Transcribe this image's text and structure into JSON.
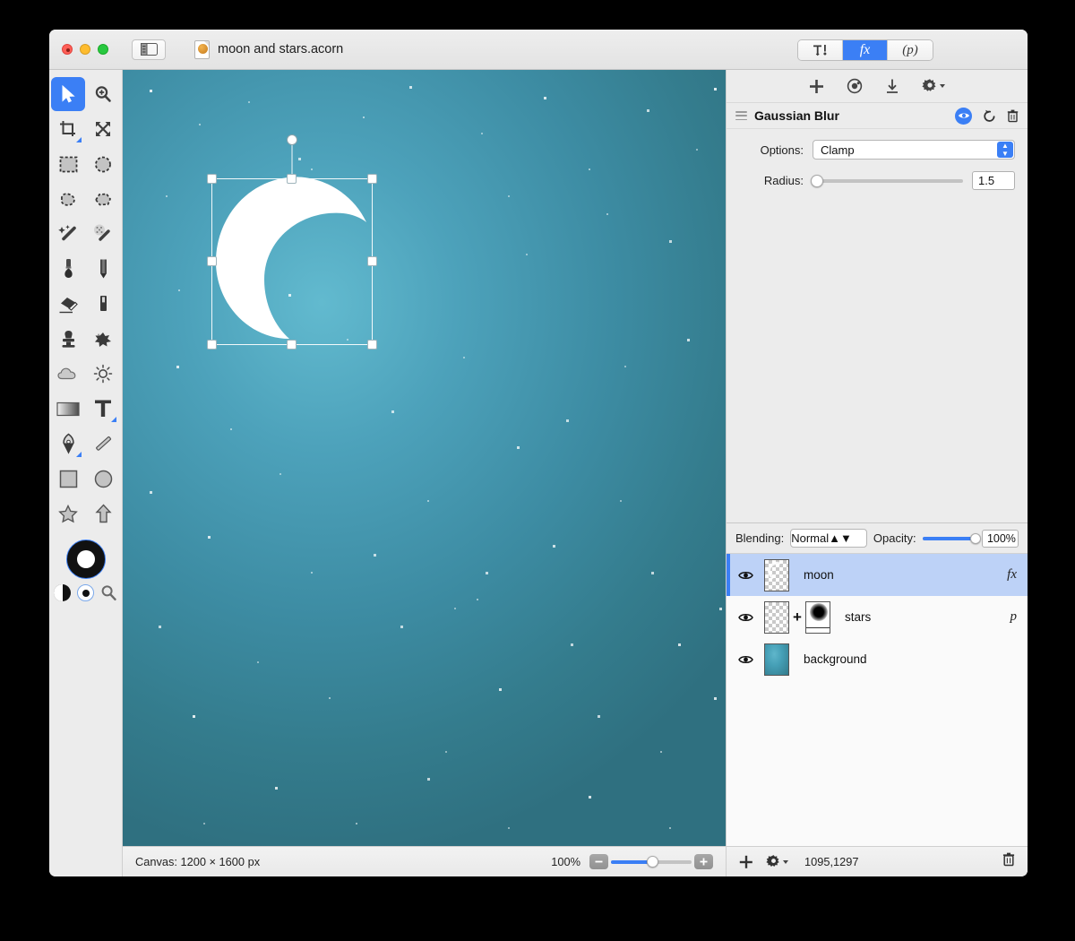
{
  "window": {
    "document_title": "moon and stars.acorn",
    "traffic_lights": [
      "close",
      "minimize",
      "zoom"
    ],
    "sidebar_toggle_icon": "sidebar-toggle-icon",
    "doc_icon": "acorn-document-icon"
  },
  "segmented_control": {
    "items": [
      {
        "id": "tools",
        "label": "",
        "icon": "tools-hammer-icon",
        "active": false
      },
      {
        "id": "filters",
        "label": "fx",
        "icon": "fx-icon",
        "active": true
      },
      {
        "id": "presets",
        "label": "(p)",
        "icon": "p-icon",
        "active": false
      }
    ]
  },
  "tools": {
    "items": [
      {
        "name": "move-tool",
        "icon": "cursor-arrow-icon",
        "selected": true
      },
      {
        "name": "zoom-tool",
        "icon": "magnifier-plus-icon",
        "selected": false
      },
      {
        "name": "crop-tool",
        "icon": "crop-icon",
        "selected": false,
        "has_options": true
      },
      {
        "name": "transform-tool",
        "icon": "move-arrows-icon",
        "selected": false
      },
      {
        "name": "rectangular-select-tool",
        "icon": "rect-marquee-icon",
        "selected": false
      },
      {
        "name": "elliptical-select-tool",
        "icon": "ellipse-marquee-icon",
        "selected": false
      },
      {
        "name": "lasso-tool",
        "icon": "lasso-icon",
        "selected": false
      },
      {
        "name": "polygon-lasso-tool",
        "icon": "polygon-lasso-icon",
        "selected": false
      },
      {
        "name": "magic-wand-tool",
        "icon": "magic-wand-icon",
        "selected": false
      },
      {
        "name": "instant-alpha-tool",
        "icon": "instant-alpha-wand-icon",
        "selected": false
      },
      {
        "name": "paint-brush-tool",
        "icon": "paint-brush-icon",
        "selected": false
      },
      {
        "name": "pencil-tool",
        "icon": "pencil-icon",
        "selected": false
      },
      {
        "name": "eraser-tool",
        "icon": "eraser-icon",
        "selected": false
      },
      {
        "name": "paint-bucket-tool",
        "icon": "paint-bucket-icon",
        "selected": false
      },
      {
        "name": "clone-stamp-tool",
        "icon": "clone-stamp-icon",
        "selected": false
      },
      {
        "name": "smudge-tool",
        "icon": "smudge-splat-icon",
        "selected": false
      },
      {
        "name": "dodge-tool",
        "icon": "cloud-icon",
        "selected": false
      },
      {
        "name": "burn-tool",
        "icon": "sun-icon",
        "selected": false
      },
      {
        "name": "gradient-tool",
        "icon": "gradient-icon",
        "selected": false
      },
      {
        "name": "text-tool",
        "icon": "text-t-icon",
        "selected": false,
        "has_options": true
      },
      {
        "name": "bezier-pen-tool",
        "icon": "pen-nib-icon",
        "selected": false,
        "has_options": true
      },
      {
        "name": "line-tool",
        "icon": "line-icon",
        "selected": false
      },
      {
        "name": "rectangle-shape-tool",
        "icon": "rectangle-icon",
        "selected": false
      },
      {
        "name": "ellipse-shape-tool",
        "icon": "circle-icon",
        "selected": false
      },
      {
        "name": "star-shape-tool",
        "icon": "star-icon",
        "selected": false
      },
      {
        "name": "arrow-shape-tool",
        "icon": "arrow-up-icon",
        "selected": false
      }
    ],
    "color_well": {
      "name": "foreground-background-color-well",
      "foreground": "#ffffff",
      "background": "#111111"
    },
    "mini_controls": [
      {
        "name": "swap-colors-button",
        "icon": "swap-colors-icon"
      },
      {
        "name": "reset-colors-button",
        "icon": "reset-colors-icon"
      },
      {
        "name": "color-picker-button",
        "icon": "magnifier-icon"
      }
    ]
  },
  "inspector": {
    "toolbar": [
      {
        "name": "add-filter-button",
        "icon": "plus-icon"
      },
      {
        "name": "color-profile-button",
        "icon": "color-wheel-icon"
      },
      {
        "name": "download-preset-button",
        "icon": "download-arrow-icon"
      },
      {
        "name": "filter-settings-button",
        "icon": "gear-icon"
      }
    ],
    "filter": {
      "name": "Gaussian Blur",
      "grip_icon": "drag-grip-icon",
      "enabled": true,
      "actions": [
        {
          "name": "toggle-filter-visibility",
          "icon": "eye-icon",
          "active": true
        },
        {
          "name": "reset-filter-button",
          "icon": "reset-arrow-icon"
        },
        {
          "name": "delete-filter-button",
          "icon": "trash-icon"
        }
      ],
      "rows": [
        {
          "label": "Options:",
          "type": "popup",
          "value": "Clamp"
        },
        {
          "label": "Radius:",
          "type": "slider",
          "value": "1.5",
          "slider_pct": 3
        }
      ]
    }
  },
  "layers_panel": {
    "blending_label": "Blending:",
    "blending_value": "Normal",
    "opacity_label": "Opacity:",
    "opacity_value": "100%",
    "opacity_pct": 100,
    "layers": [
      {
        "name": "moon",
        "selected": true,
        "visible": true,
        "badge": "fx",
        "thumb_type": "checker",
        "has_mask": false
      },
      {
        "name": "stars",
        "selected": false,
        "visible": true,
        "badge": "p",
        "thumb_type": "checker",
        "has_mask": true
      },
      {
        "name": "background",
        "selected": false,
        "visible": true,
        "badge": "",
        "thumb_type": "teal",
        "has_mask": false
      }
    ],
    "footer": {
      "add_layer_icon": "plus-icon",
      "layer_actions_icon": "gear-icon",
      "coordinates": "1095,1297",
      "delete_layer_icon": "trash-icon"
    }
  },
  "status_bar": {
    "canvas_info": "Canvas: 1200 × 1600 px",
    "zoom_level": "100%",
    "zoom_out_icon": "minus-icon",
    "zoom_in_icon": "plus-icon",
    "zoom_slider_pct": 52
  },
  "canvas": {
    "selection_handles": 8,
    "rotation_handle": "rotation-handle",
    "artwork": "crescent-moon",
    "colors": {
      "gradient_center": "#62bacf",
      "gradient_edge": "#2f7080",
      "moon_fill": "#ffffff"
    }
  },
  "colors": {
    "accent": "#3b7ff5",
    "selection_row": "#bdd2f7",
    "window_chrome": "#ececec"
  }
}
